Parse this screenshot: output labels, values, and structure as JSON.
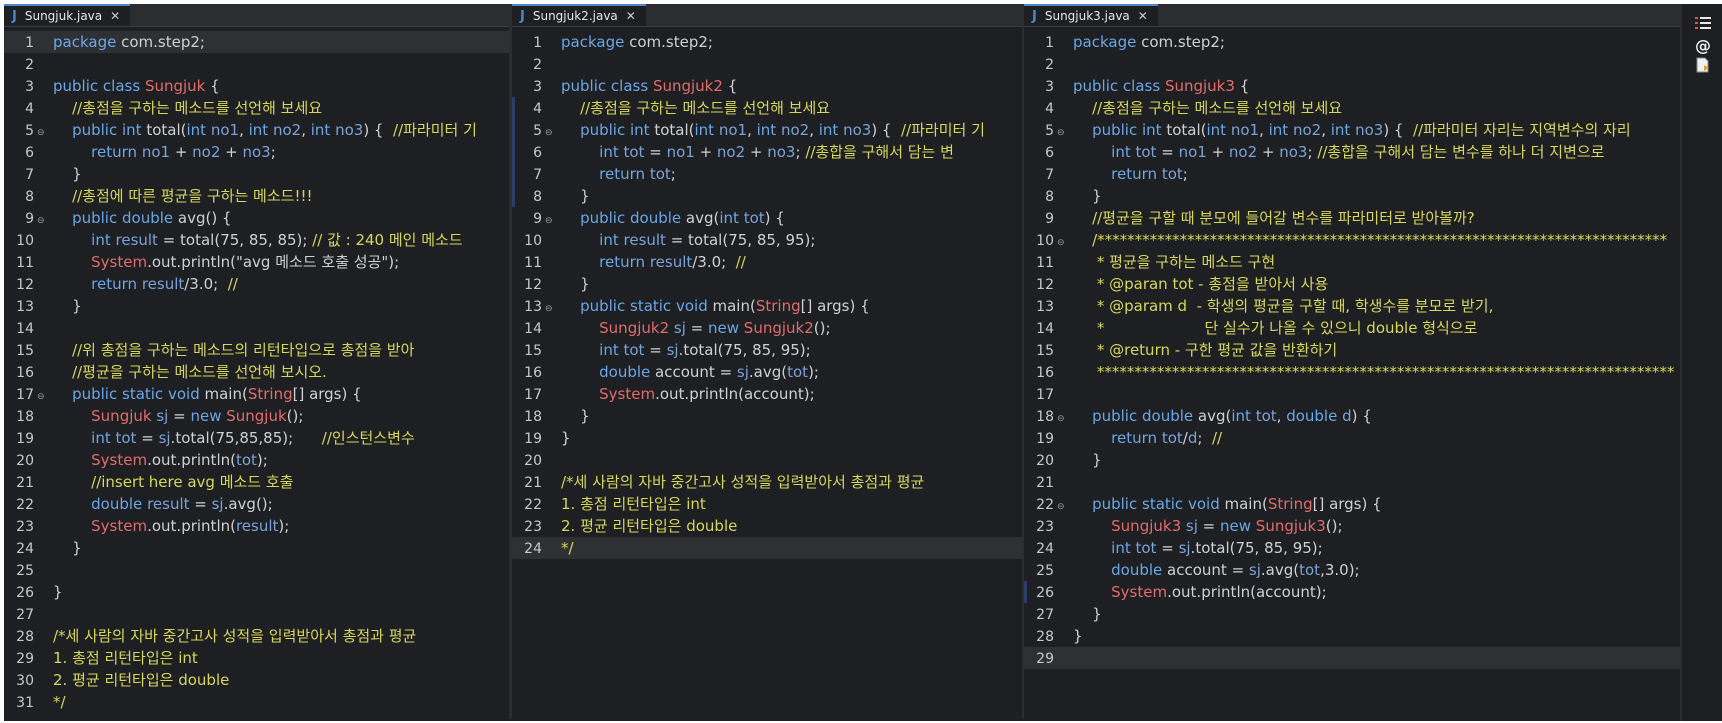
{
  "editors": [
    {
      "tab": "Sungjuk.java",
      "lines": [
        {
          "n": "1",
          "t": "package com.step2;"
        },
        {
          "n": "2",
          "t": ""
        },
        {
          "n": "3",
          "t": "public class Sungjuk {"
        },
        {
          "n": "4",
          "t": "    //총점을 구하는 메소드를 선언해 보세요"
        },
        {
          "n": "5",
          "t": "    public int total(int no1, int no2, int no3) {  //파라미터 기"
        },
        {
          "n": "6",
          "t": "        return no1 + no2 + no3;"
        },
        {
          "n": "7",
          "t": "    }"
        },
        {
          "n": "8",
          "t": "    //총점에 따른 평균을 구하는 메소드!!!"
        },
        {
          "n": "9",
          "t": "    public double avg() {"
        },
        {
          "n": "10",
          "t": "        int result = total(75, 85, 85); // 값 : 240 메인 메소드"
        },
        {
          "n": "11",
          "t": "        System.out.println(\"avg 메소드 호출 성공\");"
        },
        {
          "n": "12",
          "t": "        return result/3.0;  //"
        },
        {
          "n": "13",
          "t": "    }"
        },
        {
          "n": "14",
          "t": ""
        },
        {
          "n": "15",
          "t": "    //위 총점을 구하는 메소드의 리턴타입으로 총점을 받아"
        },
        {
          "n": "16",
          "t": "    //평균을 구하는 메소드를 선언해 보시오."
        },
        {
          "n": "17",
          "t": "    public static void main(String[] args) {"
        },
        {
          "n": "18",
          "t": "        Sungjuk sj = new Sungjuk();"
        },
        {
          "n": "19",
          "t": "        int tot = sj.total(75,85,85);      //인스턴스변수"
        },
        {
          "n": "20",
          "t": "        System.out.println(tot);"
        },
        {
          "n": "21",
          "t": "        //insert here avg 메소드 호출"
        },
        {
          "n": "22",
          "t": "        double result = sj.avg();"
        },
        {
          "n": "23",
          "t": "        System.out.println(result);"
        },
        {
          "n": "24",
          "t": "    }"
        },
        {
          "n": "25",
          "t": ""
        },
        {
          "n": "26",
          "t": "}"
        },
        {
          "n": "27",
          "t": ""
        },
        {
          "n": "28",
          "t": "/*세 사람의 자바 중간고사 성적을 입력받아서 총점과 평균"
        },
        {
          "n": "29",
          "t": "1. 총점 리턴타입은 int"
        },
        {
          "n": "30",
          "t": "2. 평균 리턴타입은 double"
        },
        {
          "n": "31",
          "t": "*/"
        }
      ]
    },
    {
      "tab": "Sungjuk2.java",
      "lines": [
        {
          "n": "1",
          "t": "package com.step2;"
        },
        {
          "n": "2",
          "t": ""
        },
        {
          "n": "3",
          "t": "public class Sungjuk2 {"
        },
        {
          "n": "4",
          "t": "    //총점을 구하는 메소드를 선언해 보세요"
        },
        {
          "n": "5",
          "t": "    public int total(int no1, int no2, int no3) {  //파라미터 기"
        },
        {
          "n": "6",
          "t": "        int tot = no1 + no2 + no3; //총합을 구해서 담는 변"
        },
        {
          "n": "7",
          "t": "        return tot;"
        },
        {
          "n": "8",
          "t": "    }"
        },
        {
          "n": "9",
          "t": "    public double avg(int tot) {"
        },
        {
          "n": "10",
          "t": "        int result = total(75, 85, 95);"
        },
        {
          "n": "11",
          "t": "        return result/3.0;  //"
        },
        {
          "n": "12",
          "t": "    }"
        },
        {
          "n": "13",
          "t": "    public static void main(String[] args) {"
        },
        {
          "n": "14",
          "t": "        Sungjuk2 sj = new Sungjuk2();"
        },
        {
          "n": "15",
          "t": "        int tot = sj.total(75, 85, 95);"
        },
        {
          "n": "16",
          "t": "        double account = sj.avg(tot);"
        },
        {
          "n": "17",
          "t": "        System.out.println(account);"
        },
        {
          "n": "18",
          "t": "    }"
        },
        {
          "n": "19",
          "t": "}"
        },
        {
          "n": "20",
          "t": ""
        },
        {
          "n": "21",
          "t": "/*세 사람의 자바 중간고사 성적을 입력받아서 총점과 평균"
        },
        {
          "n": "22",
          "t": "1. 총점 리턴타입은 int"
        },
        {
          "n": "23",
          "t": "2. 평균 리턴타입은 double"
        },
        {
          "n": "24",
          "t": "*/"
        }
      ]
    },
    {
      "tab": "Sungjuk3.java",
      "lines": [
        {
          "n": "1",
          "t": "package com.step2;"
        },
        {
          "n": "2",
          "t": ""
        },
        {
          "n": "3",
          "t": "public class Sungjuk3 {"
        },
        {
          "n": "4",
          "t": "    //총점을 구하는 메소드를 선언해 보세요"
        },
        {
          "n": "5",
          "t": "    public int total(int no1, int no2, int no3) {  //파라미터 자리는 지역변수의 자리"
        },
        {
          "n": "6",
          "t": "        int tot = no1 + no2 + no3; //총합을 구해서 담는 변수를 하나 더 지변으로"
        },
        {
          "n": "7",
          "t": "        return tot;"
        },
        {
          "n": "8",
          "t": "    }"
        },
        {
          "n": "9",
          "t": "    //평균을 구할 때 분모에 들어갈 변수를 파라미터로 받아볼까?"
        },
        {
          "n": "10",
          "t": "    /****************************************************************************"
        },
        {
          "n": "11",
          "t": "     * 평균을 구하는 메소드 구현"
        },
        {
          "n": "12",
          "t": "     * @paran tot - 총점을 받아서 사용"
        },
        {
          "n": "13",
          "t": "     * @param d  - 학생의 평균을 구할 때, 학생수를 분모로 받기,"
        },
        {
          "n": "14",
          "t": "     *                     단 실수가 나올 수 있으니 double 형식으로"
        },
        {
          "n": "15",
          "t": "     * @return - 구한 평균 값을 반환하기"
        },
        {
          "n": "16",
          "t": "     *****************************************************************************"
        },
        {
          "n": "17",
          "t": ""
        },
        {
          "n": "18",
          "t": "    public double avg(int tot, double d) {"
        },
        {
          "n": "19",
          "t": "        return tot/d;  //"
        },
        {
          "n": "20",
          "t": "    }"
        },
        {
          "n": "21",
          "t": ""
        },
        {
          "n": "22",
          "t": "    public static void main(String[] args) {"
        },
        {
          "n": "23",
          "t": "        Sungjuk3 sj = new Sungjuk3();"
        },
        {
          "n": "24",
          "t": "        int tot = sj.total(75, 85, 95);"
        },
        {
          "n": "25",
          "t": "        double account = sj.avg(tot,3.0);"
        },
        {
          "n": "26",
          "t": "        System.out.println(account);"
        },
        {
          "n": "27",
          "t": "    }"
        },
        {
          "n": "28",
          "t": "}"
        },
        {
          "n": "29",
          "t": ""
        }
      ]
    }
  ],
  "side_icons": [
    "task-list-icon",
    "at-sign-icon",
    "document-icon"
  ],
  "colors": {
    "background": "#1e1f22",
    "keyword": "#6aa7e6",
    "class_name": "#e06c6c",
    "comment": "#d7d75a"
  }
}
